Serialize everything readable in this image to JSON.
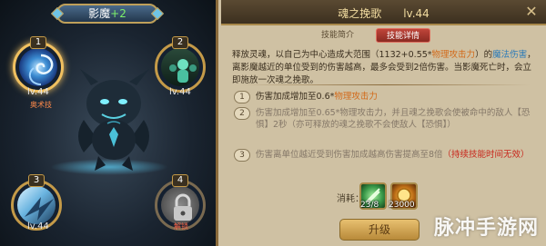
{
  "hero": {
    "name": "影魔",
    "plus": "+2"
  },
  "skills": [
    {
      "slot": "1",
      "level": "lv.44",
      "tag": "奥术技",
      "icon": "swirl-vortex-icon"
    },
    {
      "slot": "2",
      "level": "lv.44",
      "tag": "",
      "icon": "summon-spirits-icon"
    },
    {
      "slot": "3",
      "level": "lv.44",
      "tag": "",
      "icon": "wind-blade-icon"
    },
    {
      "slot": "4",
      "level": "",
      "tag": "解锁",
      "icon": "padlock-icon"
    }
  ],
  "detail": {
    "skill_name": "魂之挽歌",
    "skill_level": "lv.44",
    "tabs": [
      "技能简介",
      "技能详情"
    ],
    "active_tab": "技能详情",
    "description_parts": [
      {
        "text": "释放灵魂，以自己为中心造成大范围（1132+0.55*",
        "style": ""
      },
      {
        "text": "物理攻击力",
        "style": "orange"
      },
      {
        "text": "）的",
        "style": ""
      },
      {
        "text": "魔法伤害",
        "style": "blue"
      },
      {
        "text": "，离影魔越近的单位受到的伤害越高，最多会受到2倍伤害。当影魔死亡时，会立即施放一次魂之挽歌。",
        "style": ""
      }
    ],
    "upgrades": [
      {
        "num": "1",
        "state": "active",
        "parts": [
          {
            "text": "伤害加成增加至0.6*",
            "style": ""
          },
          {
            "text": "物理攻击力",
            "style": "orange"
          }
        ]
      },
      {
        "num": "2",
        "state": "dim",
        "parts": [
          {
            "text": "伤害加成增加至0.65*物理攻击力，并且魂之挽歌会使被命中的敌人【恐惧】2秒（亦可释放的魂之挽歌不会使敌人【恐惧】）",
            "style": ""
          }
        ]
      },
      {
        "num": "3",
        "state": "dim",
        "parts": [
          {
            "text": "伤害离单位越近受到伤害加成越高伤害提高至8倍",
            "style": ""
          },
          {
            "text": "（持续技能时间无效）",
            "style": "red"
          }
        ]
      }
    ],
    "cost_label": "消耗：",
    "costs": [
      {
        "icon": "skill-scroll-icon",
        "value": "23/8"
      },
      {
        "icon": "gold-coin-icon",
        "value": "23000"
      }
    ],
    "upgrade_button": "升级",
    "close_icon": "close-icon"
  },
  "watermark": "脉冲手游网"
}
